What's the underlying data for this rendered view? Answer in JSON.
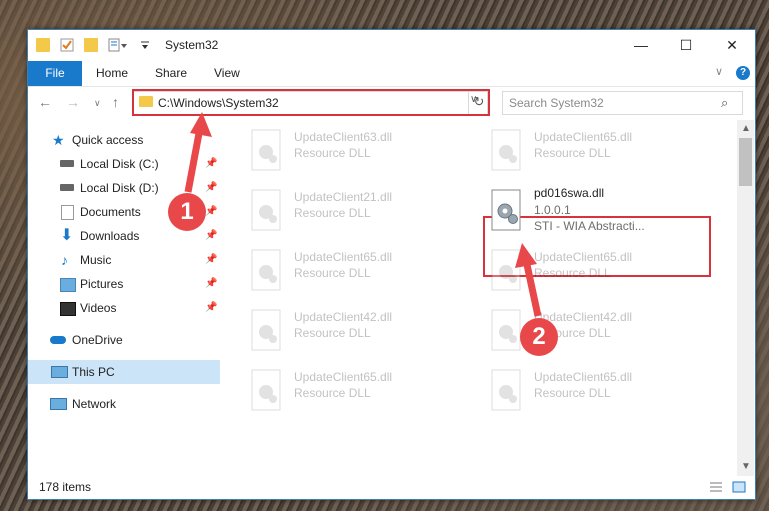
{
  "window": {
    "title": "System32",
    "minimize": "—",
    "maximize": "☐",
    "close": "✕"
  },
  "ribbon": {
    "tabs": [
      "File",
      "Home",
      "Share",
      "View"
    ],
    "collapse": "∨",
    "help": "?"
  },
  "address": {
    "path": "C:\\Windows\\System32",
    "search_placeholder": "Search System32"
  },
  "nav": {
    "items": [
      {
        "label": "Quick access",
        "icon": "star-icon"
      },
      {
        "label": "Local Disk (C:)",
        "icon": "drive-icon",
        "pinned": true
      },
      {
        "label": "Local Disk (D:)",
        "icon": "drive-icon",
        "pinned": true
      },
      {
        "label": "Documents",
        "icon": "documents-icon",
        "pinned": true
      },
      {
        "label": "Downloads",
        "icon": "download-icon",
        "pinned": true
      },
      {
        "label": "Music",
        "icon": "music-icon",
        "pinned": true
      },
      {
        "label": "Pictures",
        "icon": "pictures-icon",
        "pinned": true
      },
      {
        "label": "Videos",
        "icon": "videos-icon",
        "pinned": true
      },
      {
        "label": "OneDrive",
        "icon": "cloud-icon"
      },
      {
        "label": "This PC",
        "icon": "pc-icon",
        "selected": true
      },
      {
        "label": "Network",
        "icon": "network-icon"
      }
    ]
  },
  "files": [
    {
      "name": "UpdateClient63.dll",
      "desc": "Resource DLL"
    },
    {
      "name": "UpdateClient65.dll",
      "desc": "Resource DLL"
    },
    {
      "name": "UpdateClient21.dll",
      "desc": "Resource DLL"
    },
    {
      "name": "pd016swa.dll",
      "version": "1.0.0.1",
      "desc": "STI - WIA Abstracti..."
    },
    {
      "name": "UpdateClient65.dll",
      "desc": "Resource DLL"
    },
    {
      "name": "UpdateClient65.dll",
      "desc": "Resource DLL"
    },
    {
      "name": "UpdateClient42.dll",
      "desc": "Resource DLL"
    },
    {
      "name": "UpdateClient42.dll",
      "desc": "Resource DLL"
    },
    {
      "name": "UpdateClient65.dll",
      "desc": "Resource DLL"
    },
    {
      "name": "UpdateClient65.dll",
      "desc": "Resource DLL"
    }
  ],
  "status": {
    "count": "178 items"
  },
  "annotations": {
    "step1": "1",
    "step2": "2"
  },
  "colors": {
    "accent": "#1979ca",
    "highlight": "#d6333c",
    "selected": "#cce4f7"
  }
}
